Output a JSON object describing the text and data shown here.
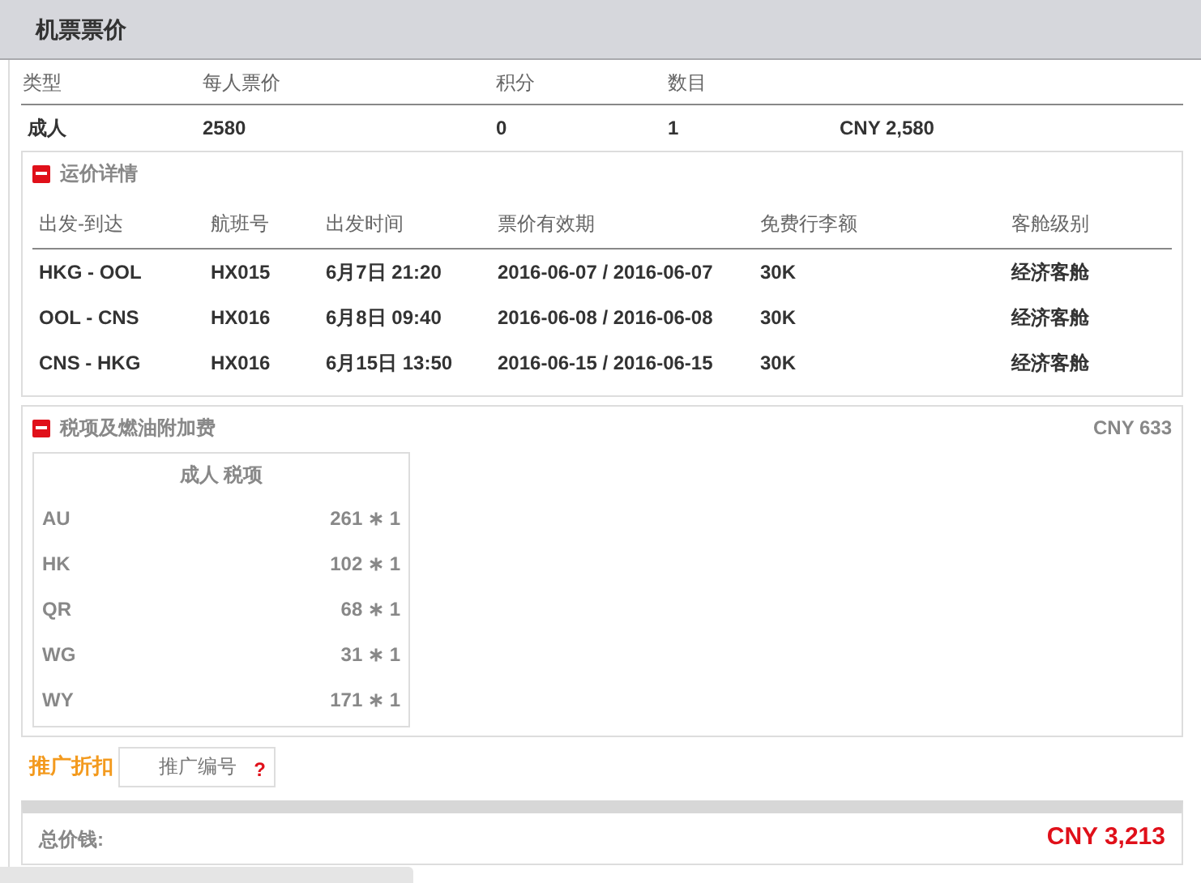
{
  "header": {
    "title": "机票票价"
  },
  "fare_table": {
    "columns": [
      "类型",
      "每人票价",
      "积分",
      "数目"
    ],
    "rows": [
      {
        "type": "成人",
        "price": "2580",
        "points": "0",
        "count": "1",
        "total": "CNY 2,580"
      }
    ]
  },
  "fare_details": {
    "title": "运价详情",
    "expanded": true,
    "columns": [
      "出发-到达",
      "航班号",
      "出发时间",
      "票价有效期",
      "免费行李额",
      "客舱级别"
    ],
    "rows": [
      [
        "HKG - OOL",
        "HX015",
        "6月7日 21:20",
        "2016-06-07 / 2016-06-07",
        "30K",
        "经济客舱"
      ],
      [
        "OOL - CNS",
        "HX016",
        "6月8日 09:40",
        "2016-06-08 / 2016-06-08",
        "30K",
        "经济客舱"
      ],
      [
        "CNS - HKG",
        "HX016",
        "6月15日 13:50",
        "2016-06-15 / 2016-06-15",
        "30K",
        "经济客舱"
      ]
    ]
  },
  "taxes": {
    "title": "税项及燃油附加费",
    "expanded": true,
    "amount": "CNY 633",
    "table_title": "成人 税项",
    "rows": [
      {
        "code": "AU",
        "value": "261 ∗ 1"
      },
      {
        "code": "HK",
        "value": "102 ∗ 1"
      },
      {
        "code": "QR",
        "value": "68 ∗ 1"
      },
      {
        "code": "WG",
        "value": "31 ∗ 1"
      },
      {
        "code": "WY",
        "value": "171 ∗ 1"
      }
    ]
  },
  "promo": {
    "label": "推广折扣",
    "placeholder": "推广编号",
    "help": "?"
  },
  "total": {
    "label": "总价钱:",
    "amount": "CNY 3,213"
  }
}
